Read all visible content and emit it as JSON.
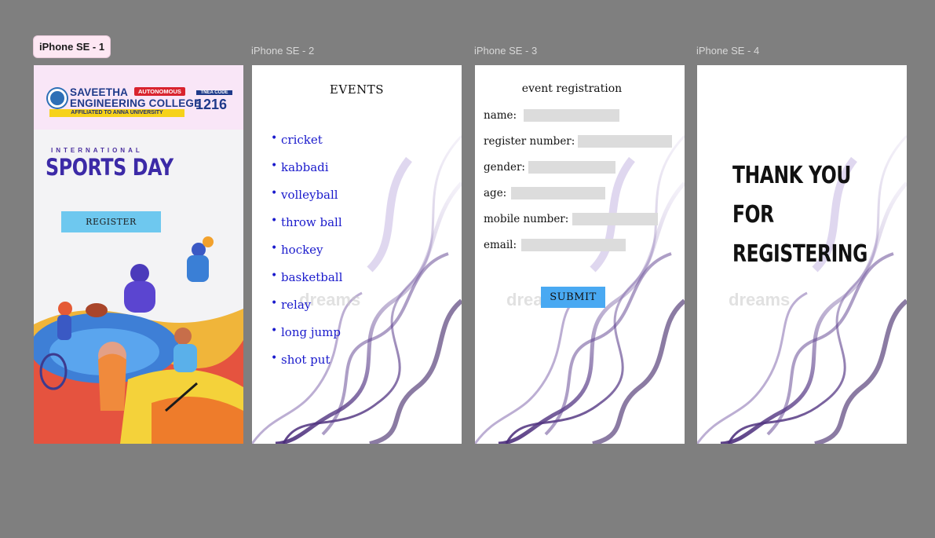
{
  "canvas": {
    "background": "#7f7f7f"
  },
  "frames": [
    {
      "label": "iPhone SE - 1",
      "selected": true
    },
    {
      "label": "iPhone SE - 2",
      "selected": false
    },
    {
      "label": "iPhone SE - 3",
      "selected": false
    },
    {
      "label": "iPhone SE - 4",
      "selected": false
    }
  ],
  "home": {
    "college_name_line1": "SAVEETHA",
    "college_name_line2": "ENGINEERING COLLEGE",
    "autonomous_badge": "AUTONOMOUS",
    "affiliation": "AFFILIATED TO ANNA UNIVERSITY",
    "tnea_label": "TNEA CODE",
    "tnea_code": "1216",
    "event_subtitle": "INTERNATIONAL",
    "event_title": "SPORTS DAY",
    "register_button": "REGISTER",
    "accent_color": "#6ec8ef"
  },
  "events": {
    "title": "EVENTS",
    "items": [
      "cricket",
      "kabbadi",
      "volleyball",
      "throw ball",
      "hockey",
      "basketball",
      "relay",
      "long jump",
      "shot put"
    ],
    "item_color": "#1a1acc",
    "watermark": "dreams"
  },
  "registration": {
    "title": "event registration",
    "fields": [
      {
        "label": "name:",
        "value": ""
      },
      {
        "label": "register number:",
        "value": ""
      },
      {
        "label": "gender:",
        "value": ""
      },
      {
        "label": "age:",
        "value": ""
      },
      {
        "label": "mobile number:",
        "value": ""
      },
      {
        "label": "email:",
        "value": ""
      }
    ],
    "submit_button": "SUBMIT",
    "submit_color": "#49a9f2",
    "watermark": "dreams"
  },
  "confirmation": {
    "line1": "THANK YOU FOR",
    "line2": "REGISTERING",
    "watermark": "dreams"
  }
}
